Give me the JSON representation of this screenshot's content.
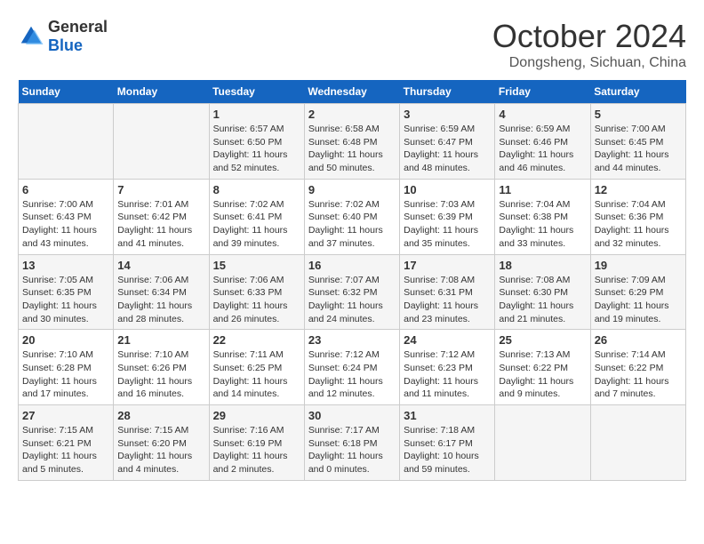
{
  "header": {
    "logo_general": "General",
    "logo_blue": "Blue",
    "month": "October 2024",
    "location": "Dongsheng, Sichuan, China"
  },
  "days_of_week": [
    "Sunday",
    "Monday",
    "Tuesday",
    "Wednesday",
    "Thursday",
    "Friday",
    "Saturday"
  ],
  "weeks": [
    [
      {
        "day": "",
        "info": ""
      },
      {
        "day": "",
        "info": ""
      },
      {
        "day": "1",
        "sunrise": "6:57 AM",
        "sunset": "6:50 PM",
        "daylight": "11 hours and 52 minutes."
      },
      {
        "day": "2",
        "sunrise": "6:58 AM",
        "sunset": "6:48 PM",
        "daylight": "11 hours and 50 minutes."
      },
      {
        "day": "3",
        "sunrise": "6:59 AM",
        "sunset": "6:47 PM",
        "daylight": "11 hours and 48 minutes."
      },
      {
        "day": "4",
        "sunrise": "6:59 AM",
        "sunset": "6:46 PM",
        "daylight": "11 hours and 46 minutes."
      },
      {
        "day": "5",
        "sunrise": "7:00 AM",
        "sunset": "6:45 PM",
        "daylight": "11 hours and 44 minutes."
      }
    ],
    [
      {
        "day": "6",
        "sunrise": "7:00 AM",
        "sunset": "6:43 PM",
        "daylight": "11 hours and 43 minutes."
      },
      {
        "day": "7",
        "sunrise": "7:01 AM",
        "sunset": "6:42 PM",
        "daylight": "11 hours and 41 minutes."
      },
      {
        "day": "8",
        "sunrise": "7:02 AM",
        "sunset": "6:41 PM",
        "daylight": "11 hours and 39 minutes."
      },
      {
        "day": "9",
        "sunrise": "7:02 AM",
        "sunset": "6:40 PM",
        "daylight": "11 hours and 37 minutes."
      },
      {
        "day": "10",
        "sunrise": "7:03 AM",
        "sunset": "6:39 PM",
        "daylight": "11 hours and 35 minutes."
      },
      {
        "day": "11",
        "sunrise": "7:04 AM",
        "sunset": "6:38 PM",
        "daylight": "11 hours and 33 minutes."
      },
      {
        "day": "12",
        "sunrise": "7:04 AM",
        "sunset": "6:36 PM",
        "daylight": "11 hours and 32 minutes."
      }
    ],
    [
      {
        "day": "13",
        "sunrise": "7:05 AM",
        "sunset": "6:35 PM",
        "daylight": "11 hours and 30 minutes."
      },
      {
        "day": "14",
        "sunrise": "7:06 AM",
        "sunset": "6:34 PM",
        "daylight": "11 hours and 28 minutes."
      },
      {
        "day": "15",
        "sunrise": "7:06 AM",
        "sunset": "6:33 PM",
        "daylight": "11 hours and 26 minutes."
      },
      {
        "day": "16",
        "sunrise": "7:07 AM",
        "sunset": "6:32 PM",
        "daylight": "11 hours and 24 minutes."
      },
      {
        "day": "17",
        "sunrise": "7:08 AM",
        "sunset": "6:31 PM",
        "daylight": "11 hours and 23 minutes."
      },
      {
        "day": "18",
        "sunrise": "7:08 AM",
        "sunset": "6:30 PM",
        "daylight": "11 hours and 21 minutes."
      },
      {
        "day": "19",
        "sunrise": "7:09 AM",
        "sunset": "6:29 PM",
        "daylight": "11 hours and 19 minutes."
      }
    ],
    [
      {
        "day": "20",
        "sunrise": "7:10 AM",
        "sunset": "6:28 PM",
        "daylight": "11 hours and 17 minutes."
      },
      {
        "day": "21",
        "sunrise": "7:10 AM",
        "sunset": "6:26 PM",
        "daylight": "11 hours and 16 minutes."
      },
      {
        "day": "22",
        "sunrise": "7:11 AM",
        "sunset": "6:25 PM",
        "daylight": "11 hours and 14 minutes."
      },
      {
        "day": "23",
        "sunrise": "7:12 AM",
        "sunset": "6:24 PM",
        "daylight": "11 hours and 12 minutes."
      },
      {
        "day": "24",
        "sunrise": "7:12 AM",
        "sunset": "6:23 PM",
        "daylight": "11 hours and 11 minutes."
      },
      {
        "day": "25",
        "sunrise": "7:13 AM",
        "sunset": "6:22 PM",
        "daylight": "11 hours and 9 minutes."
      },
      {
        "day": "26",
        "sunrise": "7:14 AM",
        "sunset": "6:22 PM",
        "daylight": "11 hours and 7 minutes."
      }
    ],
    [
      {
        "day": "27",
        "sunrise": "7:15 AM",
        "sunset": "6:21 PM",
        "daylight": "11 hours and 5 minutes."
      },
      {
        "day": "28",
        "sunrise": "7:15 AM",
        "sunset": "6:20 PM",
        "daylight": "11 hours and 4 minutes."
      },
      {
        "day": "29",
        "sunrise": "7:16 AM",
        "sunset": "6:19 PM",
        "daylight": "11 hours and 2 minutes."
      },
      {
        "day": "30",
        "sunrise": "7:17 AM",
        "sunset": "6:18 PM",
        "daylight": "11 hours and 0 minutes."
      },
      {
        "day": "31",
        "sunrise": "7:18 AM",
        "sunset": "6:17 PM",
        "daylight": "10 hours and 59 minutes."
      },
      {
        "day": "",
        "info": ""
      },
      {
        "day": "",
        "info": ""
      }
    ]
  ]
}
